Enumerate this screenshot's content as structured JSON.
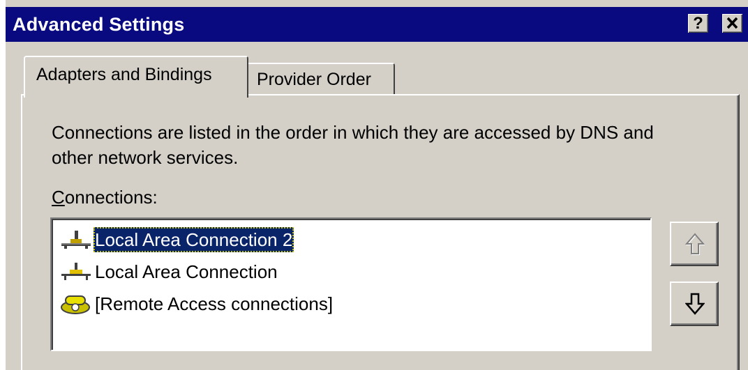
{
  "window": {
    "title": "Advanced Settings",
    "help_label": "?",
    "close_label": "✕"
  },
  "tabs": [
    {
      "label": "Adapters and Bindings",
      "active": true
    },
    {
      "label": "Provider Order",
      "active": false
    }
  ],
  "content": {
    "description": "Connections are listed in the order in which they are accessed by DNS and other network services.",
    "connections_label_accel": "C",
    "connections_label_rest": "onnections:"
  },
  "connections": [
    {
      "label": "Local Area Connection 2",
      "icon": "network-adapter-icon",
      "selected": true
    },
    {
      "label": "Local Area Connection",
      "icon": "network-adapter-icon",
      "selected": false
    },
    {
      "label": "[Remote Access connections]",
      "icon": "telephone-icon",
      "selected": false
    }
  ],
  "buttons": {
    "move_up_icon": "arrow-up-icon",
    "move_down_icon": "arrow-down-icon",
    "move_up_enabled": false,
    "move_down_enabled": true
  },
  "colors": {
    "titlebar": "#0a0a80",
    "face": "#d4d0c8",
    "selection": "#0a246a"
  }
}
